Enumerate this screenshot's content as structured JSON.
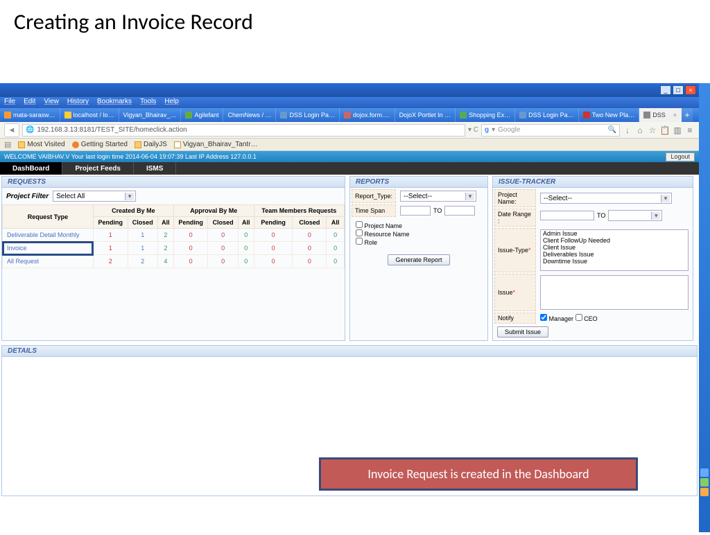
{
  "slide": {
    "title": "Creating an Invoice Record"
  },
  "browser": {
    "menu": [
      "File",
      "Edit",
      "View",
      "History",
      "Bookmarks",
      "Tools",
      "Help"
    ],
    "tabs": [
      "mata-sarasw…",
      "localhost / lo…",
      "Vigyan_Bhairav_…",
      "Agilefant",
      "ChemNews / …",
      "DSS Login Pa…",
      "dojox.form.…",
      "DojoX Portlet In …",
      "Shopping Ex…",
      "DSS Login Pa…",
      "Two New Pla…",
      "DSS"
    ],
    "tab_close": "×",
    "tab_plus": "+",
    "url": "192.168.3.13:8181/TEST_SITE/homeclick.action",
    "search_placeholder": "Google",
    "bookmarks": [
      "Most Visited",
      "Getting Started",
      "DailyJS",
      "Vigyan_Bhairav_Tantr…"
    ]
  },
  "app": {
    "welcome": "WELCOME  VAIBHAV.V   Your last login time 2014-06-04 19:07:39 Last IP Address 127.0.0.1",
    "logout": "Logout",
    "nav": [
      "DashBoard",
      "Project Feeds",
      "ISMS"
    ]
  },
  "requests": {
    "title": "REQUESTS",
    "filter_label": "Project Filter",
    "filter_value": "Select All",
    "header_groups": [
      "Created By Me",
      "Approval By Me",
      "Team Members Requests"
    ],
    "sub_headers": [
      "Request Type",
      "Pending",
      "Closed",
      "All",
      "Pending",
      "Closed",
      "All",
      "Pending",
      "Closed",
      "All"
    ],
    "rows": [
      {
        "type": "Deliverable Detail Monthly",
        "vals": [
          "1",
          "1",
          "2",
          "0",
          "0",
          "0",
          "0",
          "0",
          "0"
        ]
      },
      {
        "type": "Invoice",
        "vals": [
          "1",
          "1",
          "2",
          "0",
          "0",
          "0",
          "0",
          "0",
          "0"
        ],
        "hl": true
      },
      {
        "type": "All Request",
        "vals": [
          "2",
          "2",
          "4",
          "0",
          "0",
          "0",
          "0",
          "0",
          "0"
        ]
      }
    ]
  },
  "reports": {
    "title": "REPORTS",
    "type_label": "Report_Type:",
    "type_value": "--Select--",
    "span_label": "Time Span",
    "to": "TO",
    "checks": [
      "Project Name",
      "Resource Name",
      "Role"
    ],
    "button": "Generate Report"
  },
  "tracker": {
    "title": "ISSUE-TRACKER",
    "proj_label": "Project Name:",
    "proj_value": "--Select--",
    "date_label": "Date Range :",
    "to": "TO",
    "itype_label": "Issue-Type",
    "issues": [
      "Admin Issue",
      "Client FollowUp Needed",
      "Client Issue",
      "Deliverables Issue",
      "Downtime Issue"
    ],
    "issue_label": "Issue",
    "notify_label": "Notify",
    "notify_opts": [
      "Manager",
      "CEO"
    ],
    "submit": "Submit Issue"
  },
  "details": {
    "title": "DETAILS"
  },
  "callout": "Invoice Request is created in the Dashboard"
}
